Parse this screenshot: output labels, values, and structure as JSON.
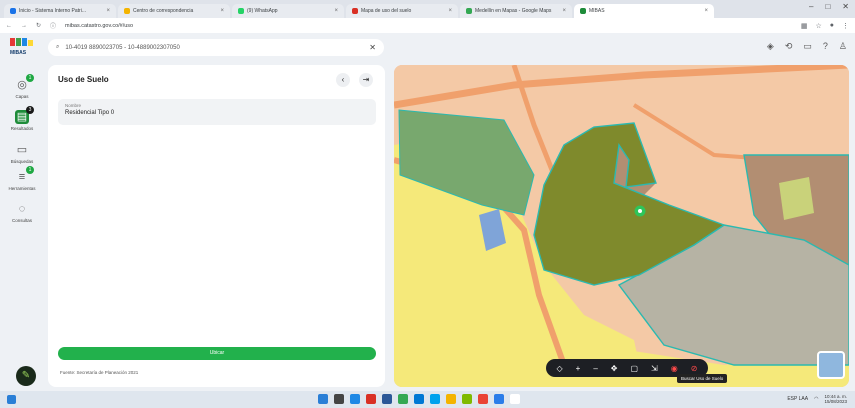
{
  "browser": {
    "tabs": [
      {
        "label": "Inicio - Sistema Interno Patri...",
        "color": "#1a73e8",
        "active": false
      },
      {
        "label": "Centro de correspondencia",
        "color": "#f4b400",
        "active": false
      },
      {
        "label": "(9) WhatsApp",
        "color": "#25d366",
        "active": false
      },
      {
        "label": "Mapa de uso del suelo",
        "color": "#d93025",
        "active": false
      },
      {
        "label": "Medellín en Mapas - Google Maps",
        "color": "#34a853",
        "active": false
      },
      {
        "label": "MIBAS",
        "color": "#1e8c3a",
        "active": true
      }
    ],
    "url": "mibas.catastro.gov.co/#/uso",
    "window_controls": [
      "–",
      "□",
      "✕"
    ]
  },
  "app": {
    "logo_text": "MIBAS",
    "logo_colors": [
      "#e53935",
      "#43a047",
      "#1e88e5",
      "#fdd835"
    ],
    "search_value": "10-4019 8890023705 - 10-4889002307050",
    "header_icons": [
      "layers-icon",
      "share-icon",
      "chat-icon",
      "help-icon",
      "user-icon"
    ]
  },
  "rail": [
    {
      "name": "rail-item-capas",
      "label": "Capas",
      "icon": "◎",
      "badge": "1",
      "badge_dark": false,
      "selected": false
    },
    {
      "name": "rail-item-resultados",
      "label": "Resultados",
      "icon": "▤",
      "badge": "3",
      "badge_dark": true,
      "selected": true
    },
    {
      "name": "rail-item-busquedas",
      "label": "Búsquedas",
      "icon": "▭",
      "badge": "",
      "badge_dark": false,
      "selected": false
    },
    {
      "name": "rail-item-herramientas",
      "label": "Herramientas",
      "icon": "≡",
      "badge": "1",
      "badge_dark": false,
      "selected": false
    },
    {
      "name": "rail-item-consultas",
      "label": "Consultas",
      "icon": "◌",
      "badge": "",
      "badge_dark": false,
      "selected": false
    }
  ],
  "panel": {
    "title": "Uso de Suelo",
    "back_icon": "‹",
    "collapse_icon": "⇥",
    "field_label": "Nombre",
    "field_value": "Residencial Tipo 0",
    "action_button": "Ubicar",
    "footer": "Fuente: Secretaría de Planeación 2021"
  },
  "map": {
    "toolbar": [
      "◇",
      "+",
      "–",
      "✥",
      "▢",
      "⇲",
      "◉",
      "⊘"
    ],
    "tooltip": "Buscar Uso de Suelo",
    "colors": {
      "base": "#f4c9a6",
      "yellow": "#f5e97a",
      "green_zone": "#78a86e",
      "olive_zone": "#7f8a2c",
      "brown_zone": "#b28e72",
      "gray_zone": "#b6b3a4",
      "road": "#f0a06c",
      "water": "#7fa4d8",
      "outline": "#2bb9b0",
      "marker": "#2ec55a"
    }
  },
  "taskbar": {
    "app_colors": [
      "#2a7fd6",
      "#444",
      "#1e88e5",
      "#d93025",
      "#2b5797",
      "#34a853",
      "#0078d4",
      "#00a2ed",
      "#f4b400",
      "#7fba00",
      "#ea4335",
      "#2b7de9",
      "#fff"
    ],
    "tray_text": "ESP LAA",
    "time": "10:44 a. m.",
    "date": "15/08/2023"
  }
}
